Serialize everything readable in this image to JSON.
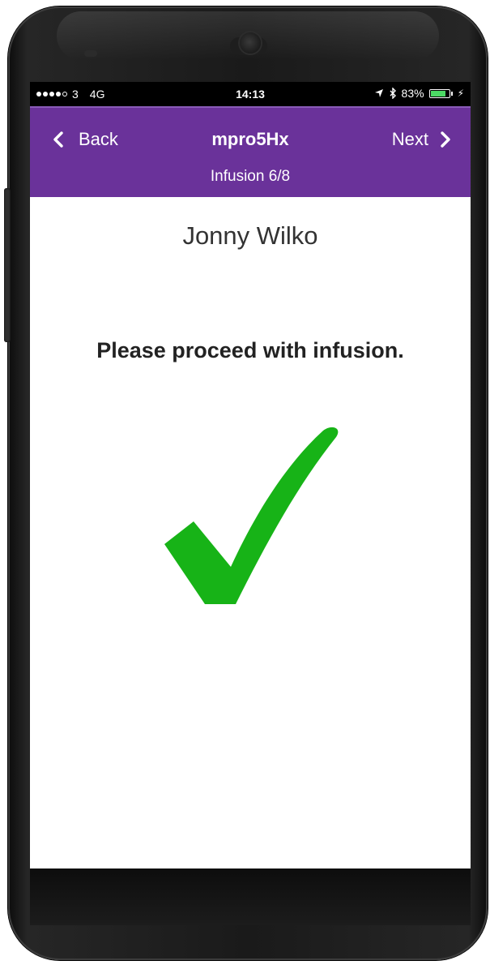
{
  "status_bar": {
    "carrier": "3",
    "network": "4G",
    "time": "14:13",
    "battery_percent": "83%",
    "battery_level": 0.83,
    "signal_bars_filled": 4,
    "signal_bars_total": 5
  },
  "nav": {
    "back_label": "Back",
    "title": "mpro5Hx",
    "subtitle": "Infusion 6/8",
    "next_label": "Next"
  },
  "content": {
    "patient_name": "Jonny Wilko",
    "message": "Please proceed with infusion."
  },
  "colors": {
    "nav_background": "#6a329a",
    "check_green": "#17b317",
    "battery_green": "#4cd964"
  },
  "icons": {
    "back": "chevron-left-icon",
    "next": "chevron-right-icon",
    "confirmation": "checkmark-icon",
    "location": "location-arrow-icon",
    "bluetooth": "bluetooth-icon",
    "battery": "battery-icon",
    "charging": "charging-bolt-icon"
  }
}
